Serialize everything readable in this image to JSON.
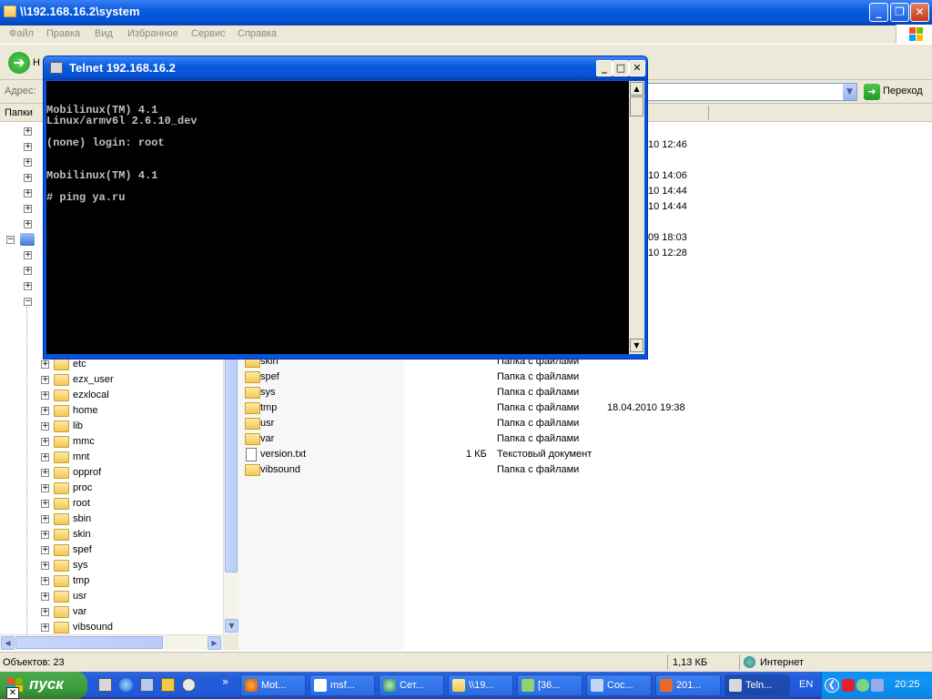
{
  "explorer": {
    "title": "\\\\192.168.16.2\\system",
    "menu": [
      "Файл",
      "Правка",
      "Вид",
      "Избранное",
      "Сервис",
      "Справка"
    ],
    "back_label": "Н",
    "address_label": "Адрес:",
    "go_label": "Переход",
    "folders_tab": "Папки",
    "tree": [
      "etc",
      "ezx_user",
      "ezxlocal",
      "home",
      "lib",
      "mmc",
      "mnt",
      "opprof",
      "proc",
      "root",
      "sbin",
      "skin",
      "spef",
      "sys",
      "tmp",
      "usr",
      "var",
      "vibsound"
    ],
    "partial_dates": [
      "10 12:46",
      "10 14:06",
      "10 14:44",
      "10 14:44",
      "09 18:03",
      "10 12:28"
    ],
    "files": [
      {
        "name": "skin",
        "size": "",
        "type": "Папка с файлами",
        "date": ""
      },
      {
        "name": "spef",
        "size": "",
        "type": "Папка с файлами",
        "date": ""
      },
      {
        "name": "sys",
        "size": "",
        "type": "Папка с файлами",
        "date": ""
      },
      {
        "name": "tmp",
        "size": "",
        "type": "Папка с файлами",
        "date": "18.04.2010 19:38"
      },
      {
        "name": "usr",
        "size": "",
        "type": "Папка с файлами",
        "date": ""
      },
      {
        "name": "var",
        "size": "",
        "type": "Папка с файлами",
        "date": ""
      },
      {
        "name": "version.txt",
        "size": "1 КБ",
        "type": "Текстовый документ",
        "date": ""
      },
      {
        "name": "vibsound",
        "size": "",
        "type": "Папка с файлами",
        "date": ""
      }
    ],
    "status": {
      "objects": "Объектов: 23",
      "size": "1,13 КБ",
      "zone": "Интернет"
    }
  },
  "telnet": {
    "title": "Telnet 192.168.16.2",
    "lines": [
      "Mobilinux(TM) 4.1",
      "Linux/armv6l 2.6.10_dev",
      "(none) login: root",
      "Mobilinux(TM) 4.1",
      "# ping ya.ru"
    ]
  },
  "taskbar": {
    "start_label": "пуск",
    "buttons": [
      "Mot...",
      "msf...",
      "Сет...",
      "\\\\19...",
      "[36...",
      "Coc...",
      "201...",
      "Teln..."
    ],
    "lang": "EN",
    "clock": "20:25"
  },
  "colors": {
    "xp_blue": "#0553d8",
    "start_green": "#3d9e3d",
    "console_bg": "#000000",
    "console_fg": "#c0c0c0"
  }
}
